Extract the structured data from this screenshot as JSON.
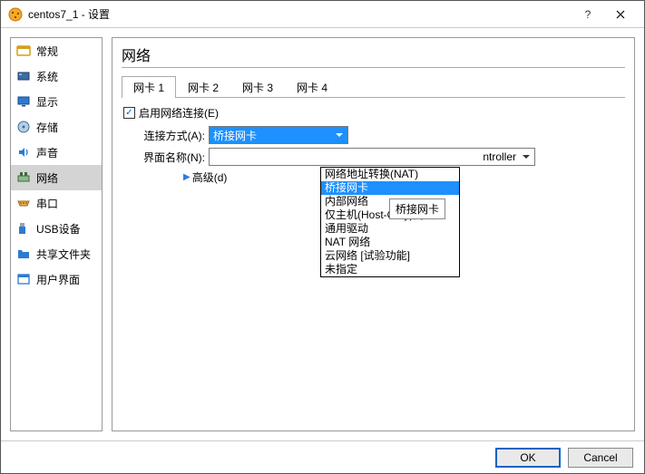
{
  "window": {
    "title": "centos7_1 - 设置",
    "help": "?",
    "close": "✕"
  },
  "sidebar": {
    "items": [
      {
        "label": "常规"
      },
      {
        "label": "系统"
      },
      {
        "label": "显示"
      },
      {
        "label": "存储"
      },
      {
        "label": "声音"
      },
      {
        "label": "网络"
      },
      {
        "label": "串口"
      },
      {
        "label": "USB设备"
      },
      {
        "label": "共享文件夹"
      },
      {
        "label": "用户界面"
      }
    ]
  },
  "content": {
    "title": "网络",
    "tabs": [
      {
        "label": "网卡 1"
      },
      {
        "label": "网卡 2"
      },
      {
        "label": "网卡 3"
      },
      {
        "label": "网卡 4"
      }
    ],
    "enable_label": "启用网络连接(E)",
    "connect_label": "连接方式(A):",
    "connect_value": "桥接网卡",
    "interface_label": "界面名称(N):",
    "interface_value": "ntroller",
    "advanced_label": "高级(d)",
    "dropdown_options": [
      "网络地址转换(NAT)",
      "桥接网卡",
      "内部网络",
      "仅主机(Host-Only)网络",
      "通用驱动",
      "NAT 网络",
      "云网络 [试验功能]",
      "未指定"
    ],
    "tooltip": "桥接网卡"
  },
  "footer": {
    "ok": "OK",
    "cancel": "Cancel"
  }
}
